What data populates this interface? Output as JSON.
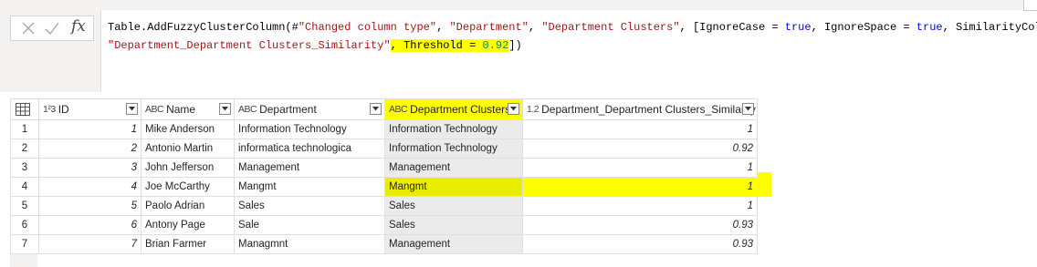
{
  "formula_bar": {
    "fx_label": "fx",
    "line1": {
      "t1": "Table.AddFuzzyClusterColumn(#",
      "t2": "\"Changed column type\"",
      "t3": ", ",
      "t4": "\"Department\"",
      "t5": ", ",
      "t6": "\"Department Clusters\"",
      "t7": ", [IgnoreCase = ",
      "t8": "true",
      "t9": ", IgnoreSpace = ",
      "t10": "true",
      "t11": ", SimilarityColumnName = "
    },
    "line2": {
      "t1": "\"Department_Department Clusters_Similarity\"",
      "t2": ", Threshold = ",
      "t3": "0.92",
      "t4": "])"
    }
  },
  "grid": {
    "columns": [
      {
        "type_icon": "1²3",
        "name": "ID"
      },
      {
        "type_icon": "ABC",
        "name": "Name"
      },
      {
        "type_icon": "ABC",
        "name": "Department"
      },
      {
        "type_icon": "ABC",
        "name": "Department Clusters"
      },
      {
        "type_icon": "1.2",
        "name": "Department_Department Clusters_Similarity"
      }
    ],
    "rows": [
      {
        "row": "1",
        "id": "1",
        "name": "Mike Anderson",
        "department": "Information Technology",
        "cluster": "Information Technology",
        "similarity": "1"
      },
      {
        "row": "2",
        "id": "2",
        "name": "Antonio Martin",
        "department": "informatica technologica",
        "cluster": "Information Technology",
        "similarity": "0.92"
      },
      {
        "row": "3",
        "id": "3",
        "name": "John Jefferson",
        "department": "Management",
        "cluster": "Management",
        "similarity": "1"
      },
      {
        "row": "4",
        "id": "4",
        "name": "Joe McCarthy",
        "department": "Mangmt",
        "cluster": "Mangmt",
        "similarity": "1"
      },
      {
        "row": "5",
        "id": "5",
        "name": "Paolo Adrian",
        "department": "Sales",
        "cluster": "Sales",
        "similarity": "1"
      },
      {
        "row": "6",
        "id": "6",
        "name": "Antony Page",
        "department": "Sale",
        "cluster": "Sales",
        "similarity": "0.93"
      },
      {
        "row": "7",
        "id": "7",
        "name": "Brian Farmer",
        "department": "Managmnt",
        "cluster": "Management",
        "similarity": "0.93"
      }
    ]
  },
  "colors": {
    "highlight": "#ffff00",
    "string": "#a31515",
    "keyword": "#0000ff",
    "number": "#098658"
  }
}
